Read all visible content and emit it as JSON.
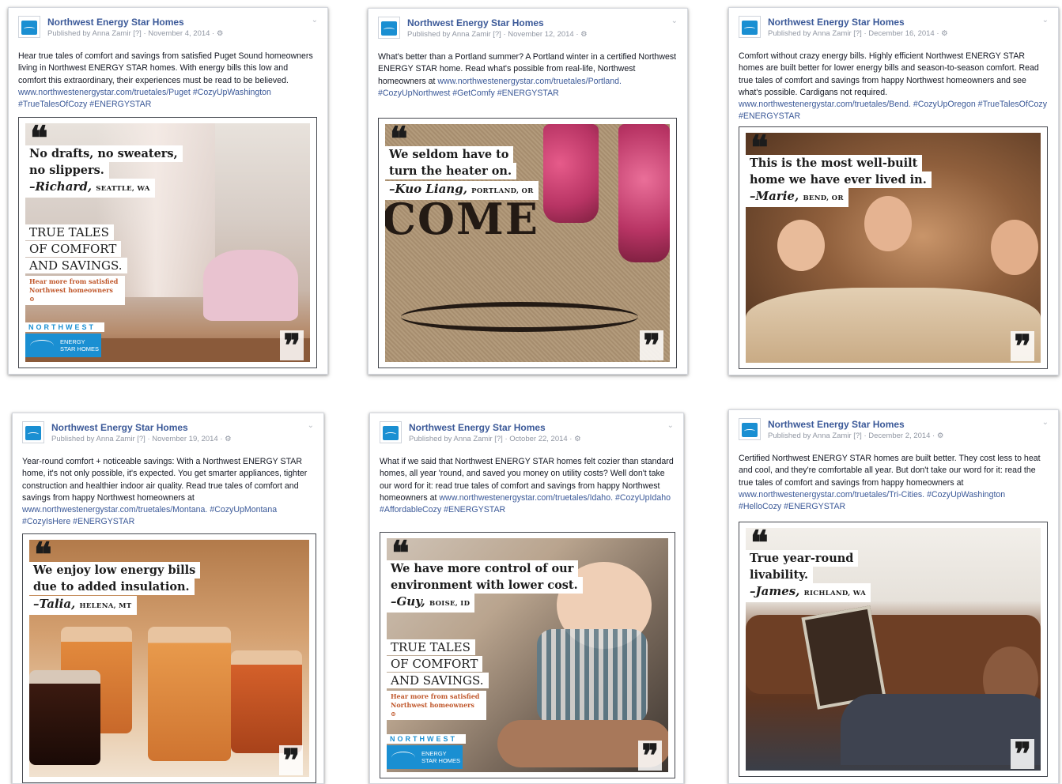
{
  "posts": [
    {
      "page_name": "Northwest Energy Star Homes",
      "meta": "Published by Anna Zamir [?] · November 4, 2014 · ⚙",
      "body": "Hear true tales of comfort and savings from satisfied Puget Sound homeowners living in Northwest ENERGY STAR homes. With energy bills this low and comfort this extraordinary, their experiences must be read to be believed.",
      "link": "www.northwestenergystar.com/truetales/Puget",
      "hashtags": "#CozyUpWashington #TrueTalesOfCozy #ENERGYSTAR",
      "quote_lines": [
        "No drafts, no sweaters,",
        "no slippers."
      ],
      "attribution_name": "–Richard,",
      "attribution_city": "SEATTLE, WA",
      "true_tales": [
        "TRUE TALES",
        "OF COMFORT",
        "AND SAVINGS."
      ],
      "hear_more": "Hear more from satisfied Northwest homeowners ⊙",
      "logo_word": "NORTHWEST",
      "logo_text": "ENERGY STAR HOMES"
    },
    {
      "page_name": "Northwest Energy Star Homes",
      "meta": "Published by Anna Zamir [?] · November 12, 2014 · ⚙",
      "body": "What's better than a Portland summer? A Portland winter in a certified Northwest ENERGY STAR home. Read what's possible from real-life, Northwest homeowners at",
      "link": "www.northwestenergystar.com/truetales/Portland.",
      "hashtags": "#CozyUpNorthwest #GetComfy #ENERGYSTAR",
      "quote_lines": [
        "We seldom have to",
        "turn the heater on."
      ],
      "attribution_name": "–Kuo Liang,",
      "attribution_city": "PORTLAND, OR",
      "mat_text": "COME"
    },
    {
      "page_name": "Northwest Energy Star Homes",
      "meta": "Published by Anna Zamir [?] · December 16, 2014 · ⚙",
      "body": "Comfort without crazy energy bills. Highly efficient Northwest ENERGY STAR homes are built better for lower energy bills and season-to-season comfort. Read true tales of comfort and savings from happy Northwest homeowners and see what's possible. Cardigans not required.",
      "link": "www.northwestenergystar.com/truetales/Bend.",
      "hashtags": "#CozyUpOregon #TrueTalesOfCozy #ENERGYSTAR",
      "quote_lines": [
        "This is the most well-built",
        "home we have ever lived in."
      ],
      "attribution_name": "–Marie,",
      "attribution_city": "BEND, OR"
    },
    {
      "page_name": "Northwest Energy Star Homes",
      "meta": "Published by Anna Zamir [?] · November 19, 2014 · ⚙",
      "body": "Year-round comfort + noticeable savings: With a Northwest ENERGY STAR home, it's not only possible, it's expected. You get smarter appliances, tighter construction and healthier indoor air quality. Read true tales of comfort and savings from happy Northwest homeowners at",
      "link": "www.northwestenergystar.com/truetales/Montana.",
      "hashtags": "#CozyUpMontana #CozyIsHere #ENERGYSTAR",
      "quote_lines": [
        "We enjoy low energy bills",
        "due to added insulation."
      ],
      "attribution_name": "–Talia,",
      "attribution_city": "HELENA, MT"
    },
    {
      "page_name": "Northwest Energy Star Homes",
      "meta": "Published by Anna Zamir [?] · October 22, 2014 · ⚙",
      "body": "What if we said that Northwest ENERGY STAR homes felt cozier than standard homes, all year 'round, and saved you money on utility costs? Well don't take our word for it: read true tales of comfort and savings from happy Northwest homeowners at",
      "link": "www.northwestenergystar.com/truetales/Idaho.",
      "hashtags": "#CozyUpIdaho #AffordableCozy #ENERGYSTAR",
      "quote_lines": [
        "We have more control of our",
        "environment with lower cost."
      ],
      "attribution_name": "–Guy,",
      "attribution_city": "BOISE, ID",
      "true_tales": [
        "TRUE TALES",
        "OF COMFORT",
        "AND SAVINGS."
      ],
      "hear_more": "Hear more from satisfied Northwest homeowners ⊙",
      "logo_word": "NORTHWEST",
      "logo_text": "ENERGY STAR HOMES"
    },
    {
      "page_name": "Northwest Energy Star Homes",
      "meta": "Published by Anna Zamir [?] · December 2, 2014 · ⚙",
      "body": "Certified Northwest ENERGY STAR homes are built better. They cost less to heat and cool, and they're comfortable all year. But don't take our word for it: read the true tales of comfort and savings from happy homeowners at",
      "link": "www.northwestenergystar.com/truetales/Tri-Cities.",
      "hashtags": "#CozyUpWashington #HelloCozy #ENERGYSTAR",
      "quote_lines": [
        "True year-round",
        "livability."
      ],
      "attribution_name": "–James,",
      "attribution_city": "RICHLAND, WA"
    }
  ],
  "quote_open": "❝",
  "quote_close": "❞",
  "colors": {
    "link": "#3b5998",
    "meta": "#9197a3",
    "brand_blue": "#1a8fd2"
  },
  "icons": [
    "page-avatar-icon",
    "chevron-down-icon",
    "gear-icon",
    "energy-star-logo-icon"
  ]
}
